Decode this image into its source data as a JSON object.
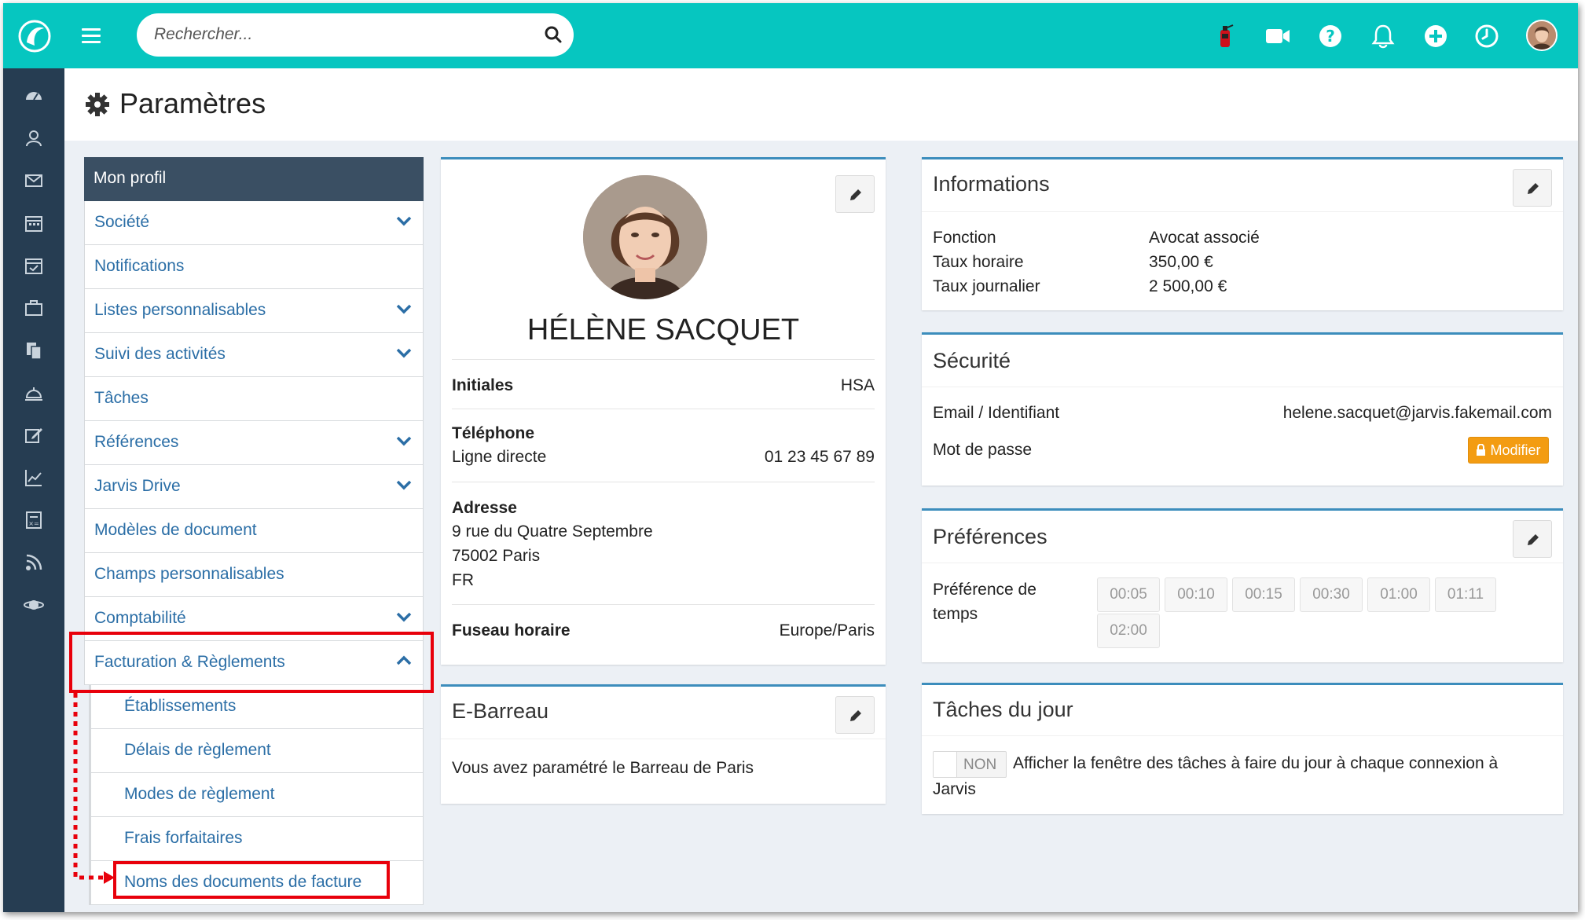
{
  "topbar": {
    "search_placeholder": "Rechercher...",
    "icons": [
      "logo-icon",
      "menu-icon",
      "search-icon",
      "fire-extinguisher-icon",
      "video-camera-icon",
      "help-icon",
      "bell-icon",
      "plus-circle-icon",
      "clock-icon",
      "user-avatar"
    ]
  },
  "page": {
    "title": "Paramètres"
  },
  "menu": {
    "header": "Mon profil",
    "items": [
      {
        "label": "Société"
      },
      {
        "label": "Notifications"
      },
      {
        "label": "Listes personnalisables"
      },
      {
        "label": "Suivi des activités"
      },
      {
        "label": "Tâches"
      },
      {
        "label": "Références"
      },
      {
        "label": "Jarvis Drive"
      },
      {
        "label": "Modèles de document"
      },
      {
        "label": "Champs personnalisables"
      },
      {
        "label": "Comptabilité"
      },
      {
        "label": "Facturation & Règlements"
      }
    ],
    "subitems": [
      {
        "label": "Établissements"
      },
      {
        "label": "Délais de règlement"
      },
      {
        "label": "Modes de règlement"
      },
      {
        "label": "Frais forfaitaires"
      },
      {
        "label": "Noms des documents de facture"
      }
    ]
  },
  "profile": {
    "name": "HÉLÈNE SACQUET",
    "initials_label": "Initiales",
    "initials": "HSA",
    "phone_label": "Téléphone",
    "phone_sub_label": "Ligne directe",
    "phone": "01 23 45 67 89",
    "address_label": "Adresse",
    "address_line1": "9 rue du Quatre Septembre",
    "address_line2": "75002 Paris",
    "address_line3": "FR",
    "timezone_label": "Fuseau horaire",
    "timezone": "Europe/Paris"
  },
  "ebarreau": {
    "title": "E-Barreau",
    "text": "Vous avez paramétré le Barreau de Paris"
  },
  "informations": {
    "title": "Informations",
    "rows": [
      {
        "label": "Fonction",
        "value": "Avocat associé"
      },
      {
        "label": "Taux horaire",
        "value": "350,00 €"
      },
      {
        "label": "Taux journalier",
        "value": "2 500,00 €"
      }
    ]
  },
  "securite": {
    "title": "Sécurité",
    "email_label": "Email / Identifiant",
    "email": "helene.sacquet@jarvis.fakemail.com",
    "password_label": "Mot de passe",
    "modify_label": "Modifier"
  },
  "preferences": {
    "title": "Préférences",
    "time_label_1": "Préférence de",
    "time_label_2": "temps",
    "times": [
      "00:05",
      "00:10",
      "00:15",
      "00:30",
      "01:00",
      "01:11",
      "02:00"
    ]
  },
  "taches": {
    "title": "Tâches du jour",
    "toggle_label": "NON",
    "text_1": "Afficher la fenêtre des tâches à faire du jour à chaque connexion à",
    "text_2": "Jarvis"
  },
  "colors": {
    "topbar": "#06c6c0",
    "rail": "#263d52",
    "menu_header": "#3a4f63",
    "link": "#2b6ea6",
    "card_border": "#3c8dbc",
    "highlight": "#e8000b",
    "button_orange": "#f39c12"
  }
}
